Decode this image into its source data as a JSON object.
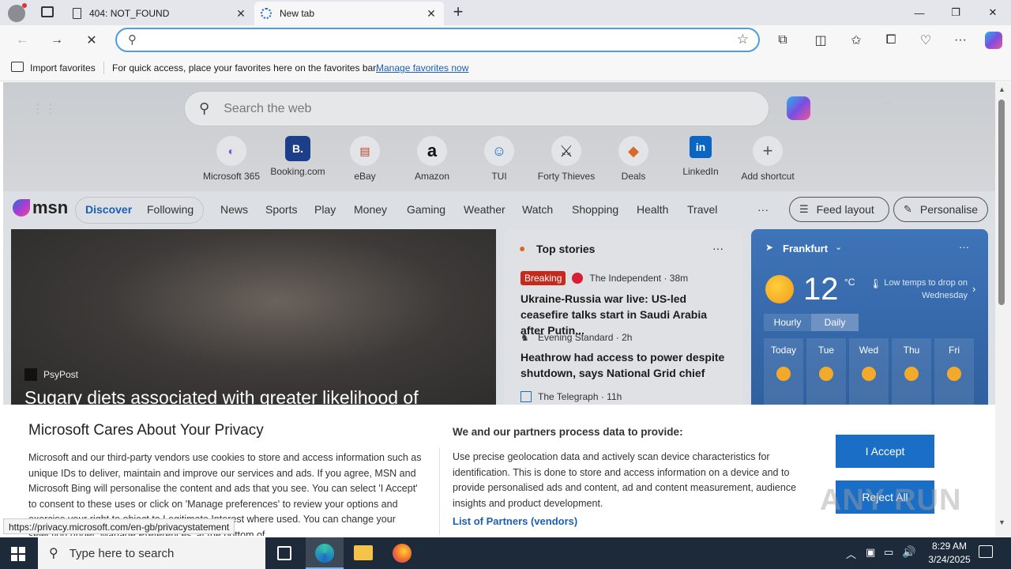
{
  "browser": {
    "tabs": [
      {
        "label": "404: NOT_FOUND"
      },
      {
        "label": "New tab"
      }
    ],
    "address_value": "",
    "favorites_bar": {
      "import_label": "Import favorites",
      "hint_text": "For quick access, place your favorites here on the favorites bar.",
      "manage_link": "Manage favorites now"
    }
  },
  "newtab": {
    "search_placeholder": "Search the web",
    "shortcuts": [
      {
        "label": "Microsoft 365",
        "glyph": "◐"
      },
      {
        "label": "Booking.com",
        "glyph": "B."
      },
      {
        "label": "eBay",
        "glyph": "▤"
      },
      {
        "label": "Amazon",
        "glyph": "a"
      },
      {
        "label": "TUI",
        "glyph": "☺"
      },
      {
        "label": "Forty Thieves",
        "glyph": "⚔"
      },
      {
        "label": "Deals",
        "glyph": "◆"
      },
      {
        "label": "LinkedIn",
        "glyph": "in"
      },
      {
        "label": "Add shortcut",
        "glyph": "+"
      }
    ],
    "msn_logo": "msn",
    "nav": {
      "discover": "Discover",
      "following": "Following",
      "items": [
        "News",
        "Sports",
        "Play",
        "Money",
        "Gaming",
        "Weather",
        "Watch",
        "Shopping",
        "Health",
        "Travel"
      ],
      "more": "···",
      "feed_layout": "Feed layout",
      "personalise": "Personalise"
    },
    "hero": {
      "source": "PsyPost",
      "headline": "Sugary diets associated with greater likelihood of"
    },
    "top_stories": {
      "title": "Top stories",
      "more": "···",
      "items": [
        {
          "badge": "Breaking",
          "source": "The Independent · 38m",
          "headline": "Ukraine-Russia war live: US-led ceasefire talks start in Saudi Arabia after Putin..."
        },
        {
          "badge": "",
          "source": "Evening Standard · 2h",
          "headline": "Heathrow had access to power despite shutdown, says National Grid chief"
        },
        {
          "badge": "",
          "source": "The Telegraph · 11h",
          "headline": ""
        }
      ]
    },
    "weather": {
      "location": "Frankfurt",
      "temp": "12",
      "unit": "°C",
      "note": "Low temps to drop on Wednesday",
      "tab_hourly": "Hourly",
      "tab_daily": "Daily",
      "days": [
        "Today",
        "Tue",
        "Wed",
        "Thu",
        "Fri"
      ],
      "more": "···"
    }
  },
  "privacy": {
    "title": "Microsoft Cares About Your Privacy",
    "body": "Microsoft and our third-party vendors use cookies to store and access information such as unique IDs to deliver, maintain and improve our services and ads. If you agree, MSN and Microsoft Bing will personalise the content and ads that you see. You can select 'I Accept' to consent to these uses or click on 'Manage preferences' to review your options and exercise your right to object to Legitimate Interest where used. You can change your selection under 'Manage Preferences' at the bottom of",
    "purpose_title": "We and our partners process data to provide:",
    "purpose_body": "Use precise geolocation data and actively scan device characteristics for identification. This is done to store and access information on a device and to provide personalised ads and content, ad and content measurement, audience insights and product development.",
    "partners_link": "List of Partners (vendors)",
    "accept": "I Accept",
    "reject": "Reject All"
  },
  "status_url": "https://privacy.microsoft.com/en-gb/privacystatement",
  "watermark": "ANY RUN",
  "taskbar": {
    "search_placeholder": "Type here to search",
    "time": "8:29 AM",
    "date": "3/24/2025"
  }
}
